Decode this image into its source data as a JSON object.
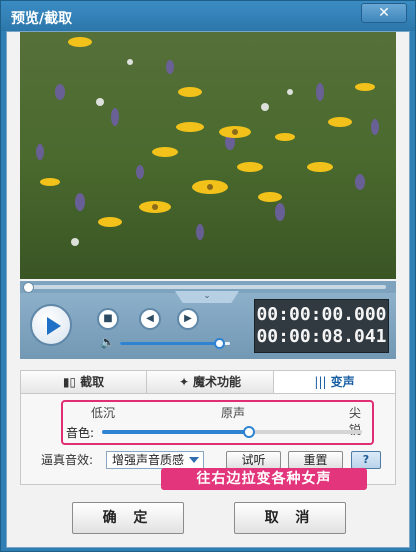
{
  "window": {
    "title": "预览/截取",
    "close_label": "✕"
  },
  "player": {
    "time_current": "00:00:00.000",
    "time_total": "00:00:08.041",
    "volume_level": 0.95,
    "seek_position": 0
  },
  "tabs": [
    {
      "label": "截取",
      "icon": "cut-icon",
      "active": false
    },
    {
      "label": "魔术功能",
      "icon": "magic-icon",
      "active": false
    },
    {
      "label": "变声",
      "icon": "waveform-icon",
      "active": true
    }
  ],
  "voice_change": {
    "labels": {
      "low": "低沉",
      "original": "原声",
      "high": "尖锐"
    },
    "timbre_label": "音色:",
    "timbre_level": 0.57,
    "effect_label": "逼真音效:",
    "effect_value": "增强声音质感",
    "preview_button": "试听",
    "reset_button": "重置",
    "help_button": "?",
    "callout": "往右边拉变各种女声"
  },
  "footer": {
    "ok_button": "确 定",
    "cancel_button": "取 消"
  },
  "colors": {
    "title_bar": "#2f7fb4",
    "accent": "#2f83d1",
    "callout": "#e3357b"
  }
}
